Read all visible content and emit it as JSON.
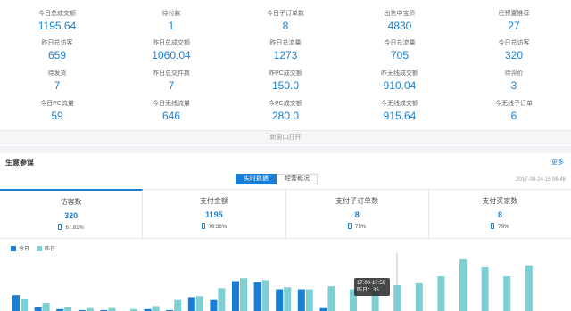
{
  "stats": [
    {
      "label": "今日总成交额",
      "value": "1195.64"
    },
    {
      "label": "待付款",
      "value": "1"
    },
    {
      "label": "今日子订单数",
      "value": "8"
    },
    {
      "label": "出售中宝贝",
      "value": "4830"
    },
    {
      "label": "已预置推荐",
      "value": "27"
    },
    {
      "label": "昨日总访客",
      "value": "659"
    },
    {
      "label": "昨日总成交额",
      "value": "1060.04"
    },
    {
      "label": "昨日总流量",
      "value": "1273"
    },
    {
      "label": "今日总流量",
      "value": "705"
    },
    {
      "label": "今日总访客",
      "value": "320"
    },
    {
      "label": "待发货",
      "value": "7"
    },
    {
      "label": "昨日总交件数",
      "value": "7"
    },
    {
      "label": "昨PC成交额",
      "value": "150.0"
    },
    {
      "label": "昨无线成交额",
      "value": "910.04"
    },
    {
      "label": "待评价",
      "value": "3"
    },
    {
      "label": "今日PC流量",
      "value": "59"
    },
    {
      "label": "今日无线流量",
      "value": "646"
    },
    {
      "label": "今PC成交额",
      "value": "280.0"
    },
    {
      "label": "今无线成交额",
      "value": "915.64"
    },
    {
      "label": "今无线子订单",
      "value": "6"
    }
  ],
  "more_window": "新窗口打开",
  "panel": {
    "title": "生意参谋",
    "more": "更多",
    "tabs": [
      "实时数据",
      "经营概况"
    ],
    "timestamp": "2017-08-24 15:06:46"
  },
  "kpis": [
    {
      "label": "访客数",
      "value": "320",
      "sub": "87.81%"
    },
    {
      "label": "支付金额",
      "value": "1195",
      "sub": "76.58%"
    },
    {
      "label": "支付子订单数",
      "value": "8",
      "sub": "75%"
    },
    {
      "label": "支付买家数",
      "value": "8",
      "sub": "75%"
    }
  ],
  "colors": {
    "accent": "#1a7fd4",
    "today": "#1a7fd4",
    "yesterday": "#7ecfd4"
  },
  "chart_data": {
    "type": "bar",
    "legend": [
      "今日",
      "昨日"
    ],
    "series": [
      {
        "name": "今日",
        "values": [
          16,
          4,
          2,
          1,
          1,
          0,
          2,
          1,
          14,
          11,
          30,
          29,
          22,
          22,
          3,
          null,
          null,
          null,
          null,
          null,
          null,
          null,
          null,
          null
        ]
      },
      {
        "name": "昨日",
        "values": [
          12,
          8,
          4,
          3,
          3,
          2,
          5,
          11,
          15,
          23,
          33,
          31,
          24,
          22,
          25,
          22,
          24,
          26,
          28,
          35,
          52,
          44,
          35,
          46
        ]
      }
    ],
    "tooltip": {
      "time": "17:00-17:59",
      "label": "昨日：35"
    }
  }
}
